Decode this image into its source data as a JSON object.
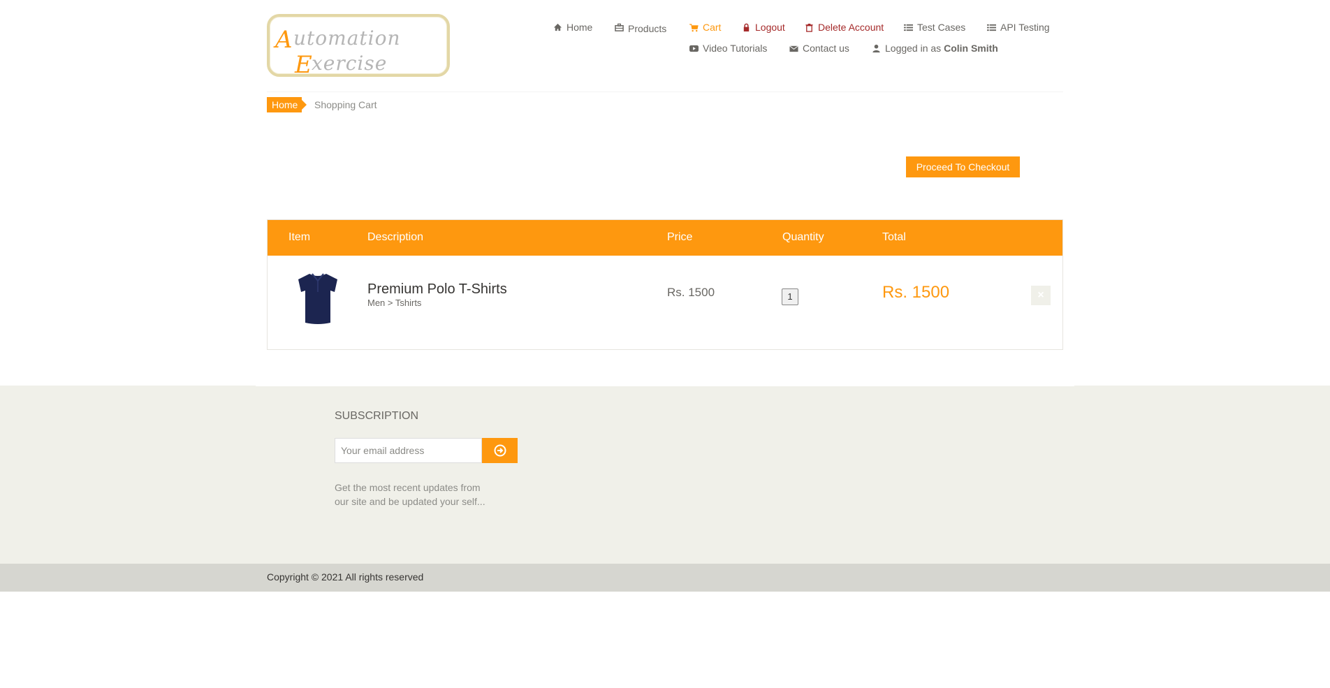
{
  "logo": {
    "line1": "Automation",
    "line2": "Exercise"
  },
  "nav": {
    "home": "Home",
    "products": "Products",
    "cart": "Cart",
    "logout": "Logout",
    "delete_account": "Delete Account",
    "test_cases": "Test Cases",
    "api_testing": "API Testing",
    "video_tutorials": "Video Tutorials",
    "contact_us": "Contact us",
    "logged_in_prefix": "Logged in as",
    "user_name": "Colin Smith"
  },
  "breadcrumb": {
    "home": "Home",
    "current": "Shopping Cart"
  },
  "checkout_label": "Proceed To Checkout",
  "cart": {
    "headers": [
      "Item",
      "Description",
      "Price",
      "Quantity",
      "Total"
    ],
    "rows": [
      {
        "name": "Premium Polo T-Shirts",
        "category": "Men > Tshirts",
        "price": "Rs. 1500",
        "quantity": "1",
        "total": "Rs. 1500",
        "delete_icon": "×"
      }
    ]
  },
  "subscription": {
    "title": "SUBSCRIPTION",
    "placeholder": "Your email address",
    "text_line1": "Get the most recent updates from",
    "text_line2": "our site and be updated your self..."
  },
  "copyright": "Copyright © 2021 All rights reserved",
  "colors": {
    "accent": "#fe980f",
    "danger": "#a52a2a",
    "footer_bg": "#f0f0e9",
    "copy_bg": "#d6d6d0"
  }
}
